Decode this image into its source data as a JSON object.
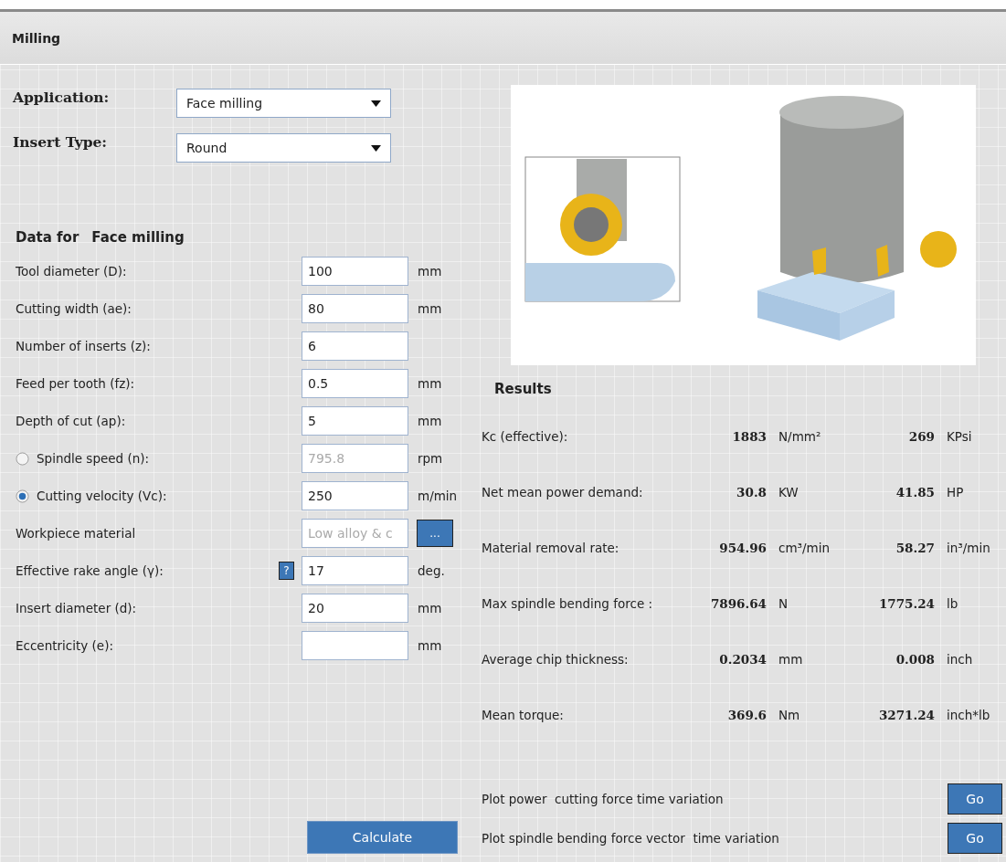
{
  "panel": {
    "title": "Milling"
  },
  "selectors": [
    {
      "label": "Application:",
      "value": "Face milling"
    },
    {
      "label": "Insert Type:",
      "value": "Round"
    }
  ],
  "data_heading": {
    "label": "Data for",
    "value": "Face milling"
  },
  "inputs": [
    {
      "kind": "text",
      "label": "Tool diameter (D):",
      "value": "100",
      "unit": "mm"
    },
    {
      "kind": "text",
      "label": "Cutting width (ae):",
      "value": "80",
      "unit": "mm"
    },
    {
      "kind": "text",
      "label": "Number of inserts (z):",
      "value": "6"
    },
    {
      "kind": "text",
      "label": "Feed per tooth (fz):",
      "value": "0.5",
      "unit": "mm"
    },
    {
      "kind": "text",
      "label": "Depth of cut (ap):",
      "value": "5",
      "unit": "mm"
    },
    {
      "kind": "radio",
      "label": "Spindle speed (n):",
      "value": "795.8",
      "unit": "rpm",
      "selected": false,
      "disabled": true
    },
    {
      "kind": "radio",
      "label": "Cutting velocity (Vc):",
      "value": "250",
      "unit": "m/min",
      "selected": true,
      "disabled": false
    },
    {
      "kind": "browse",
      "label": "Workpiece material",
      "value": "Low alloy & c",
      "button": "...",
      "disabled": true
    },
    {
      "kind": "help",
      "label": "Effective rake angle (γ):",
      "button": "?",
      "value": "17",
      "unit": "deg."
    },
    {
      "kind": "text",
      "label": "Insert diameter (d):",
      "value": "20",
      "unit": "mm"
    },
    {
      "kind": "text",
      "label": "Eccentricity (e):",
      "unit": "mm"
    }
  ],
  "calculate_button": "Calculate",
  "results": {
    "title": "Results",
    "rows": [
      {
        "label": "Kc (effective):",
        "value": "1883",
        "unit": "N/mm²",
        "value_imperial": "269",
        "unit_imperial": "KPsi"
      },
      {
        "label": "Net mean power demand:",
        "value": "30.8",
        "unit": "KW",
        "value_imperial": "41.85",
        "unit_imperial": "HP"
      },
      {
        "label": "Material removal rate:",
        "value": "954.96",
        "unit": "cm³/min",
        "value_imperial": "58.27",
        "unit_imperial": "in³/min"
      },
      {
        "label": "Max spindle bending force :",
        "value": "7896.64",
        "unit": "N",
        "value_imperial": "1775.24",
        "unit_imperial": "lb"
      },
      {
        "label": "Average chip thickness:",
        "value": "0.2034",
        "unit": "mm",
        "value_imperial": "0.008",
        "unit_imperial": "inch"
      },
      {
        "label": "Mean torque:",
        "value": "369.6",
        "unit": "Nm",
        "value_imperial": "3271.24",
        "unit_imperial": "inch*lb"
      }
    ]
  },
  "plots": [
    {
      "label": "Plot power  cutting force time variation",
      "button": "Go"
    },
    {
      "label": "Plot spindle bending force vector  time variation",
      "button": "Go"
    }
  ]
}
